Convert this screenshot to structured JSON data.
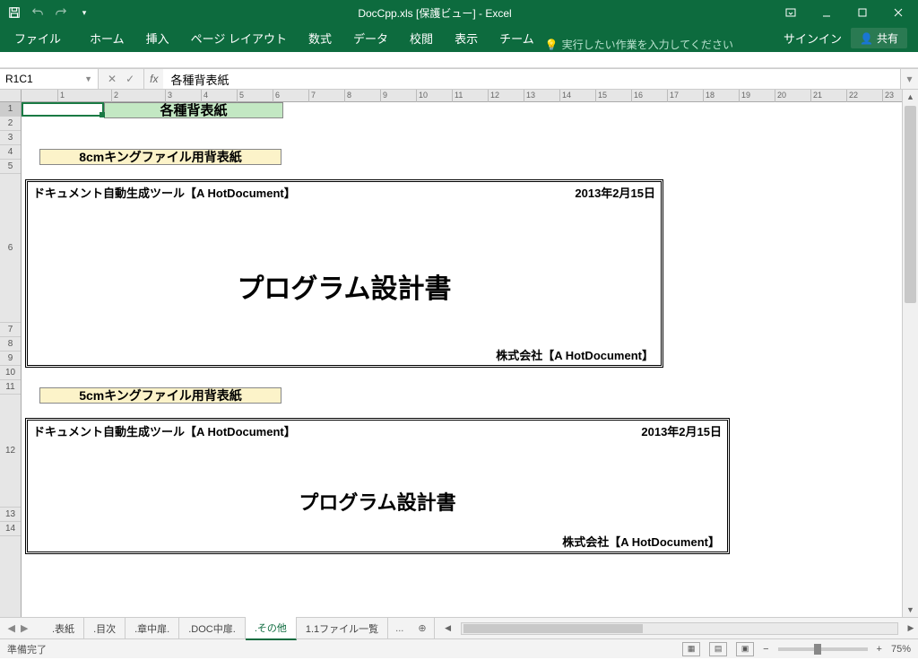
{
  "title": "DocCpp.xls [保護ビュー] - Excel",
  "qat": {
    "save": "保存",
    "undo": "元に戻す",
    "redo": "やり直し"
  },
  "win": {
    "ribbon_opts": "⿻",
    "min": "—",
    "max": "□",
    "close": "✕"
  },
  "ribbon": {
    "file": "ファイル",
    "tabs": [
      "ホーム",
      "挿入",
      "ページ レイアウト",
      "数式",
      "データ",
      "校閲",
      "表示",
      "チーム"
    ],
    "tellme": "実行したい作業を入力してください",
    "signin": "サインイン",
    "share": "共有"
  },
  "formula": {
    "namebox": "R1C1",
    "fx": "fx",
    "value": "各種背表紙"
  },
  "ruler_ticks": [
    "1",
    "2",
    "3",
    "4",
    "5",
    "6",
    "7",
    "8",
    "9",
    "10",
    "11",
    "12",
    "13",
    "14",
    "15",
    "16",
    "17",
    "18",
    "19",
    "20",
    "21",
    "22",
    "23"
  ],
  "rows": [
    "1",
    "2",
    "3",
    "4",
    "5",
    "6",
    "7",
    "8",
    "9",
    "10",
    "11",
    "12",
    "13",
    "14"
  ],
  "cells": {
    "title": "各種背表紙",
    "label8": "8cmキングファイル用背表紙",
    "label5": "5cmキングファイル用背表紙",
    "spine": {
      "tool": "ドキュメント自動生成ツール【A HotDocument】",
      "date": "2013年2月15日",
      "main": "プログラム設計書",
      "company": "株式会社【A HotDocument】"
    }
  },
  "sheet_tabs": [
    ".表紙",
    ".目次",
    ".章中扉.",
    ".DOC中扉.",
    ".その他",
    "1.1ファイル一覧"
  ],
  "sheet_more": "...",
  "status": {
    "ready": "準備完了",
    "zoom": "75%"
  }
}
